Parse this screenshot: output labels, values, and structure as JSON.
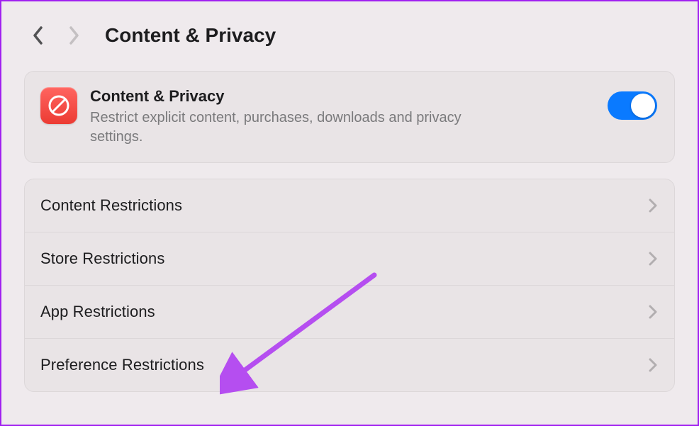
{
  "header": {
    "title": "Content & Privacy"
  },
  "toggle": {
    "title": "Content & Privacy",
    "description": "Restrict explicit content, purchases, downloads and privacy settings.",
    "enabled": true
  },
  "rows": [
    {
      "label": "Content Restrictions"
    },
    {
      "label": "Store Restrictions"
    },
    {
      "label": "App Restrictions"
    },
    {
      "label": "Preference Restrictions"
    }
  ],
  "colors": {
    "accent": "#0a7aff",
    "icon_bg_top": "#ff6560",
    "icon_bg_bottom": "#ec3b33",
    "annotation": "#b54ef0"
  }
}
